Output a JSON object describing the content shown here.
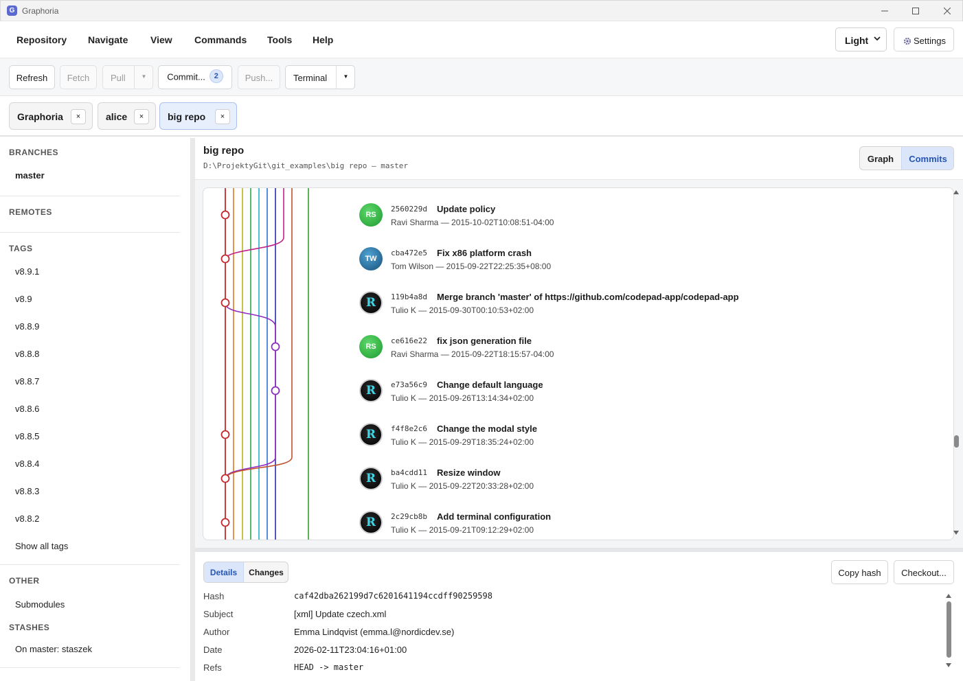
{
  "window": {
    "title": "Graphoria",
    "logo_letter": "G"
  },
  "menu": [
    "Repository",
    "Navigate",
    "View",
    "Commands",
    "Tools",
    "Help"
  ],
  "theme": {
    "selected": "Light"
  },
  "settings": {
    "label": "Settings"
  },
  "toolbar": {
    "refresh": "Refresh",
    "fetch": "Fetch",
    "pull": "Pull",
    "commit": "Commit...",
    "commit_count": "2",
    "push": "Push...",
    "terminal": "Terminal"
  },
  "repo_tabs": [
    {
      "label": "Graphoria",
      "active": false
    },
    {
      "label": "alice",
      "active": false
    },
    {
      "label": "big repo",
      "active": true
    }
  ],
  "sidebar": {
    "branches_title": "BRANCHES",
    "branches": [
      "master"
    ],
    "remotes_title": "REMOTES",
    "tags_title": "TAGS",
    "tags": [
      "v8.9.1",
      "v8.9",
      "v8.8.9",
      "v8.8.8",
      "v8.8.7",
      "v8.8.6",
      "v8.8.5",
      "v8.8.4",
      "v8.8.3",
      "v8.8.2"
    ],
    "show_all_tags": "Show all tags",
    "other_title": "OTHER",
    "submodules": "Submodules",
    "stashes_title": "STASHES",
    "stash": "On master: staszek"
  },
  "main": {
    "repo_name": "big repo",
    "repo_path": "D:\\ProjektyGit\\git_examples\\big repo — master",
    "view_graph": "Graph",
    "view_commits": "Commits",
    "active_view": "Commits"
  },
  "commits": [
    {
      "avatar": "RS",
      "avatar_style": "rs",
      "hash": "2560229d",
      "subject": "Update policy",
      "meta": "Ravi Sharma — 2015-10-02T10:08:51-04:00"
    },
    {
      "avatar": "TW",
      "avatar_style": "tw",
      "hash": "cba472e5",
      "subject": "Fix x86 platform crash",
      "meta": "Tom Wilson — 2015-09-22T22:25:35+08:00"
    },
    {
      "avatar": "R",
      "avatar_style": "tk",
      "hash": "119b4a8d",
      "subject": "Merge branch 'master' of https://github.com/codepad-app/codepad-app",
      "meta": "Tulio K — 2015-09-30T00:10:53+02:00"
    },
    {
      "avatar": "RS",
      "avatar_style": "rs",
      "hash": "ce616e22",
      "subject": "fix json generation file",
      "meta": "Ravi Sharma — 2015-09-22T18:15:57-04:00"
    },
    {
      "avatar": "R",
      "avatar_style": "tk",
      "hash": "e73a56c9",
      "subject": "Change default language",
      "meta": "Tulio K — 2015-09-26T13:14:34+02:00"
    },
    {
      "avatar": "R",
      "avatar_style": "tk",
      "hash": "f4f8e2c6",
      "subject": "Change the modal style",
      "meta": "Tulio K — 2015-09-29T18:35:24+02:00"
    },
    {
      "avatar": "R",
      "avatar_style": "tk",
      "hash": "ba4cdd11",
      "subject": "Resize window",
      "meta": "Tulio K — 2015-09-22T20:33:28+02:00"
    },
    {
      "avatar": "R",
      "avatar_style": "tk",
      "hash": "2c29cb8b",
      "subject": "Add terminal configuration",
      "meta": "Tulio K — 2015-09-21T09:12:29+02:00"
    }
  ],
  "graph_colors": {
    "main": "#c0282d",
    "lanes": [
      "#e07a1f",
      "#b9b21c",
      "#2aa84a",
      "#1fb0c9",
      "#2b6fd6",
      "#2a2ab0",
      "#8e2cc0",
      "#c0502d",
      "#34a02a"
    ],
    "merge_a": "#c0208a",
    "merge_b": "#8e2cc0"
  },
  "details": {
    "tab_details": "Details",
    "tab_changes": "Changes",
    "copy_hash": "Copy hash",
    "checkout": "Checkout...",
    "labels": {
      "hash": "Hash",
      "subject": "Subject",
      "author": "Author",
      "date": "Date",
      "refs": "Refs"
    },
    "values": {
      "hash": "caf42dba262199d7c6201641194ccdff90259598",
      "subject": "[xml] Update czech.xml",
      "author": "Emma Lindqvist (emma.l@nordicdev.se)",
      "date": "2026-02-11T23:04:16+01:00",
      "refs": "HEAD -> master"
    }
  }
}
